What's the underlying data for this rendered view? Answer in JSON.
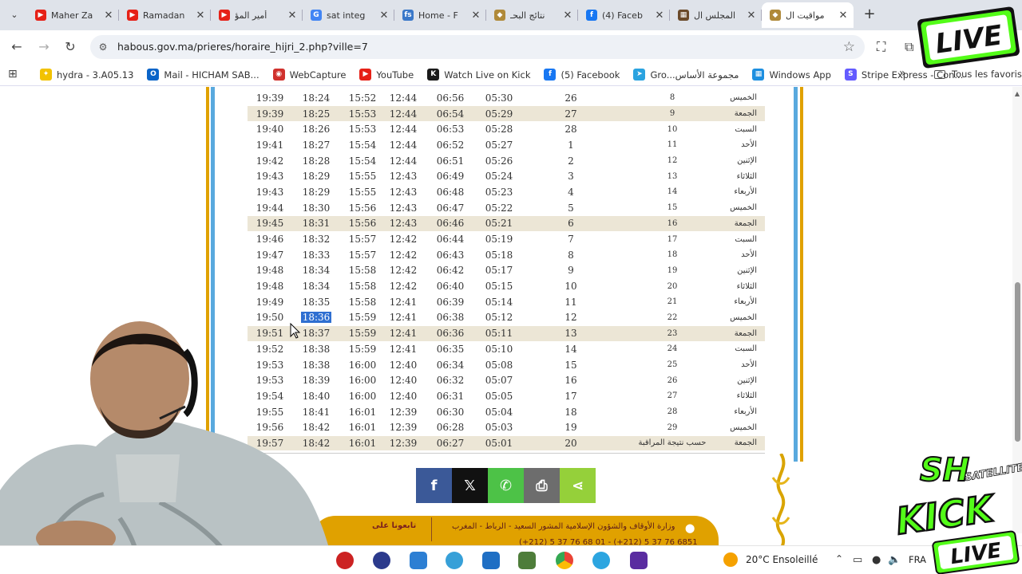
{
  "browser": {
    "tabs": [
      {
        "title": "Maher Za",
        "favicon_color": "#e62117",
        "favicon_glyph": "▶",
        "active": false
      },
      {
        "title": "Ramadan",
        "favicon_color": "#e62117",
        "favicon_glyph": "▶",
        "active": false
      },
      {
        "title": "أمير المؤ",
        "favicon_color": "#e62117",
        "favicon_glyph": "▶",
        "active": false
      },
      {
        "title": "sat integ",
        "favicon_color": "#4285f4",
        "favicon_glyph": "G",
        "active": false
      },
      {
        "title": "Home - F",
        "favicon_color": "#3a78c9",
        "favicon_glyph": "fs",
        "active": false
      },
      {
        "title": "نتائج البحـ",
        "favicon_color": "#b08a3a",
        "favicon_glyph": "◆",
        "active": false
      },
      {
        "title": "(4) Faceb",
        "favicon_color": "#1877f2",
        "favicon_glyph": "f",
        "active": false
      },
      {
        "title": "المجلس ال",
        "favicon_color": "#6b4a2a",
        "favicon_glyph": "▦",
        "active": false
      },
      {
        "title": "مواقيت ال",
        "favicon_color": "#b08a3a",
        "favicon_glyph": "◆",
        "active": true
      }
    ],
    "url": "habous.gov.ma/prieres/horaire_hijri_2.php?ville=7",
    "bookmarks": [
      {
        "label": "hydra - 3.A05.13",
        "icon_color": "#f2c200",
        "glyph": "✦"
      },
      {
        "label": "Mail - HICHAM SAB...",
        "icon_color": "#0a64c8",
        "glyph": "O"
      },
      {
        "label": "WebCapture",
        "icon_color": "#d0312d",
        "glyph": "◉"
      },
      {
        "label": "YouTube",
        "icon_color": "#e62117",
        "glyph": "▶"
      },
      {
        "label": "Watch Live on Kick",
        "icon_color": "#1a1a1a",
        "glyph": "K"
      },
      {
        "label": "(5) Facebook",
        "icon_color": "#1877f2",
        "glyph": "f"
      },
      {
        "label": "Gro...مجموعة الأساس",
        "icon_color": "#2aa3e0",
        "glyph": "➤"
      },
      {
        "label": "Windows App",
        "icon_color": "#1d8fe0",
        "glyph": "▦"
      },
      {
        "label": "Stripe Express - Con...",
        "icon_color": "#635bff",
        "glyph": "S"
      }
    ],
    "bookmarks_folder": "Tous les favoris"
  },
  "prayer_table": {
    "rows": [
      {
        "isha": "19:39",
        "maghrib": "18:24",
        "asr": "15:52",
        "dhuhr": "12:44",
        "shuruq": "06:56",
        "fajr": "05:30",
        "greg": "26",
        "hijri": "8",
        "day": "الخميس",
        "alt": false
      },
      {
        "isha": "19:39",
        "maghrib": "18:25",
        "asr": "15:53",
        "dhuhr": "12:44",
        "shuruq": "06:54",
        "fajr": "05:29",
        "greg": "27",
        "hijri": "9",
        "day": "الجمعة",
        "alt": true
      },
      {
        "isha": "19:40",
        "maghrib": "18:26",
        "asr": "15:53",
        "dhuhr": "12:44",
        "shuruq": "06:53",
        "fajr": "05:28",
        "greg": "28",
        "hijri": "10",
        "day": "السبت",
        "alt": false
      },
      {
        "isha": "19:41",
        "maghrib": "18:27",
        "asr": "15:54",
        "dhuhr": "12:44",
        "shuruq": "06:52",
        "fajr": "05:27",
        "greg": "1",
        "hijri": "11",
        "day": "الأحد",
        "alt": false
      },
      {
        "isha": "19:42",
        "maghrib": "18:28",
        "asr": "15:54",
        "dhuhr": "12:44",
        "shuruq": "06:51",
        "fajr": "05:26",
        "greg": "2",
        "hijri": "12",
        "day": "الإثنين",
        "alt": false
      },
      {
        "isha": "19:43",
        "maghrib": "18:29",
        "asr": "15:55",
        "dhuhr": "12:43",
        "shuruq": "06:49",
        "fajr": "05:24",
        "greg": "3",
        "hijri": "13",
        "day": "الثلاثاء",
        "alt": false
      },
      {
        "isha": "19:43",
        "maghrib": "18:29",
        "asr": "15:55",
        "dhuhr": "12:43",
        "shuruq": "06:48",
        "fajr": "05:23",
        "greg": "4",
        "hijri": "14",
        "day": "الأربعاء",
        "alt": false
      },
      {
        "isha": "19:44",
        "maghrib": "18:30",
        "asr": "15:56",
        "dhuhr": "12:43",
        "shuruq": "06:47",
        "fajr": "05:22",
        "greg": "5",
        "hijri": "15",
        "day": "الخميس",
        "alt": false
      },
      {
        "isha": "19:45",
        "maghrib": "18:31",
        "asr": "15:56",
        "dhuhr": "12:43",
        "shuruq": "06:46",
        "fajr": "05:21",
        "greg": "6",
        "hijri": "16",
        "day": "الجمعة",
        "alt": true
      },
      {
        "isha": "19:46",
        "maghrib": "18:32",
        "asr": "15:57",
        "dhuhr": "12:42",
        "shuruq": "06:44",
        "fajr": "05:19",
        "greg": "7",
        "hijri": "17",
        "day": "السبت",
        "alt": false
      },
      {
        "isha": "19:47",
        "maghrib": "18:33",
        "asr": "15:57",
        "dhuhr": "12:42",
        "shuruq": "06:43",
        "fajr": "05:18",
        "greg": "8",
        "hijri": "18",
        "day": "الأحد",
        "alt": false
      },
      {
        "isha": "19:48",
        "maghrib": "18:34",
        "asr": "15:58",
        "dhuhr": "12:42",
        "shuruq": "06:42",
        "fajr": "05:17",
        "greg": "9",
        "hijri": "19",
        "day": "الإثنين",
        "alt": false
      },
      {
        "isha": "19:48",
        "maghrib": "18:34",
        "asr": "15:58",
        "dhuhr": "12:42",
        "shuruq": "06:40",
        "fajr": "05:15",
        "greg": "10",
        "hijri": "20",
        "day": "الثلاثاء",
        "alt": false
      },
      {
        "isha": "19:49",
        "maghrib": "18:35",
        "asr": "15:58",
        "dhuhr": "12:41",
        "shuruq": "06:39",
        "fajr": "05:14",
        "greg": "11",
        "hijri": "21",
        "day": "الأربعاء",
        "alt": false
      },
      {
        "isha": "19:50",
        "maghrib": "18:36",
        "asr": "15:59",
        "dhuhr": "12:41",
        "shuruq": "06:38",
        "fajr": "05:12",
        "greg": "12",
        "hijri": "22",
        "day": "الخميس",
        "alt": false,
        "selected": true
      },
      {
        "isha": "19:51",
        "maghrib": "18:37",
        "asr": "15:59",
        "dhuhr": "12:41",
        "shuruq": "06:36",
        "fajr": "05:11",
        "greg": "13",
        "hijri": "23",
        "day": "الجمعة",
        "alt": true
      },
      {
        "isha": "19:52",
        "maghrib": "18:38",
        "asr": "15:59",
        "dhuhr": "12:41",
        "shuruq": "06:35",
        "fajr": "05:10",
        "greg": "14",
        "hijri": "24",
        "day": "السبت",
        "alt": false
      },
      {
        "isha": "19:53",
        "maghrib": "18:38",
        "asr": "16:00",
        "dhuhr": "12:40",
        "shuruq": "06:34",
        "fajr": "05:08",
        "greg": "15",
        "hijri": "25",
        "day": "الأحد",
        "alt": false
      },
      {
        "isha": "19:53",
        "maghrib": "18:39",
        "asr": "16:00",
        "dhuhr": "12:40",
        "shuruq": "06:32",
        "fajr": "05:07",
        "greg": "16",
        "hijri": "26",
        "day": "الإثنين",
        "alt": false
      },
      {
        "isha": "19:54",
        "maghrib": "18:40",
        "asr": "16:00",
        "dhuhr": "12:40",
        "shuruq": "06:31",
        "fajr": "05:05",
        "greg": "17",
        "hijri": "27",
        "day": "الثلاثاء",
        "alt": false
      },
      {
        "isha": "19:55",
        "maghrib": "18:41",
        "asr": "16:01",
        "dhuhr": "12:39",
        "shuruq": "06:30",
        "fajr": "05:04",
        "greg": "18",
        "hijri": "28",
        "day": "الأربعاء",
        "alt": false
      },
      {
        "isha": "19:56",
        "maghrib": "18:42",
        "asr": "16:01",
        "dhuhr": "12:39",
        "shuruq": "06:28",
        "fajr": "05:03",
        "greg": "19",
        "hijri": "29",
        "day": "الخميس",
        "alt": false
      },
      {
        "isha": "19:57",
        "maghrib": "18:42",
        "asr": "16:01",
        "dhuhr": "12:39",
        "shuruq": "06:27",
        "fajr": "05:01",
        "greg": "20",
        "hijri": "حسب نتيجة المراقبة",
        "day": "الجمعة",
        "alt": true
      }
    ]
  },
  "share": [
    {
      "name": "facebook",
      "glyph": "f",
      "color": "#3b5998"
    },
    {
      "name": "x",
      "glyph": "𝕏",
      "color": "#111111"
    },
    {
      "name": "whatsapp",
      "glyph": "✆",
      "color": "#4dc247"
    },
    {
      "name": "print",
      "glyph": "⎙",
      "color": "#6d6d6d"
    },
    {
      "name": "share",
      "glyph": "⋖",
      "color": "#95d03a"
    }
  ],
  "footer": {
    "follow": "تابعونا على",
    "address": "وزارة الأوقاف والشؤون الإسلامية المشور السعيد - الرباط - المغرب",
    "phone": "(+212) 5 37 76 68 01 - (+212) 5 37 76 6851"
  },
  "taskbar": {
    "weather": "20°C Ensoleillé",
    "lang": "FRA"
  },
  "overlay": {
    "live_text": "LIVE",
    "brand_top": "SH",
    "brand_sub": "SATELLITE",
    "kick_text": "KICK",
    "live_bottom": "LIVE",
    "accent": "#53fc18"
  }
}
